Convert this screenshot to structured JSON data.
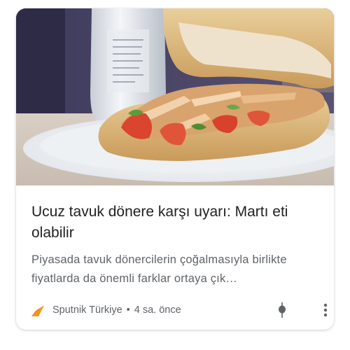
{
  "article": {
    "headline": "Ucuz tavuk dönere karşı uyarı: Martı eti olabilir",
    "snippet": "Piyasada tavuk dönercilerin çoğalmasıyla birlikte fiyatlarda da önemli farklar ortaya çık…",
    "source": "Sputnik Türkiye",
    "separator": "•",
    "time": "4 sa. önce",
    "image_icon": "doner-sandwich-photo",
    "source_icon": "sputnik-logo-icon",
    "pin_icon": "pin-icon",
    "more_icon": "more-vert-icon"
  },
  "colors": {
    "headline": "#202124",
    "secondary_text": "#5f6368",
    "source_logo": "#f7931e"
  }
}
